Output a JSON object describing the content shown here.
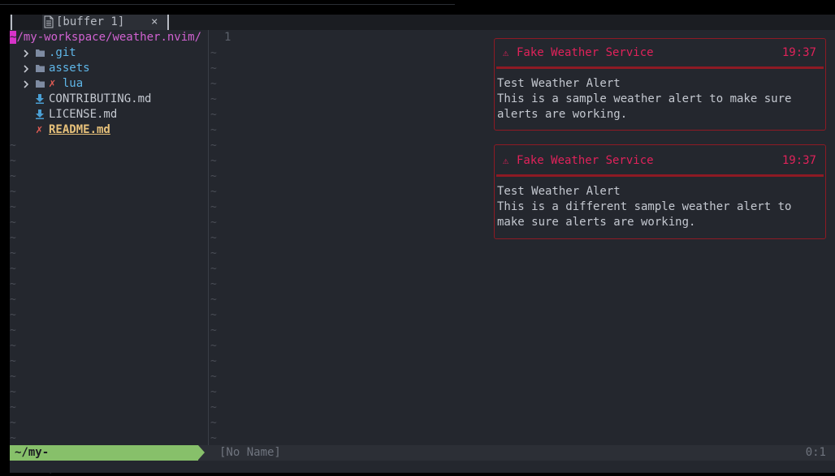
{
  "tabline": {
    "tab_label": "[buffer 1]",
    "close_glyph": "×"
  },
  "tree": {
    "root_cursor": "~",
    "root_path": "/my-workspace/weather.nvim/",
    "items": [
      {
        "name": ".git",
        "kind": "dir",
        "icon": "folder-icon"
      },
      {
        "name": "assets",
        "kind": "dir",
        "icon": "folder-icon"
      },
      {
        "name": "lua",
        "kind": "dir",
        "icon": "folder-icon",
        "status": "✗"
      },
      {
        "name": "CONTRIBUTING.md",
        "kind": "file",
        "icon": "markdown-download-icon"
      },
      {
        "name": "LICENSE.md",
        "kind": "file",
        "icon": "markdown-download-icon"
      },
      {
        "name": "README.md",
        "kind": "file",
        "status": "✗"
      }
    ]
  },
  "editor": {
    "line_number": "1",
    "tilde": "~"
  },
  "notifications": [
    {
      "icon": "⚠",
      "title": "Fake Weather Service",
      "time": "19:37",
      "heading": "Test Weather Alert",
      "body": "This is a sample weather alert to make sure alerts are working."
    },
    {
      "icon": "⚠",
      "title": "Fake Weather Service",
      "time": "19:37",
      "heading": "Test Weather Alert",
      "body": "This is a different sample weather alert to make sure alerts are working."
    }
  ],
  "statusline": {
    "path": "~/my-workspace/weather.nvim",
    "buffer_name": "[No Name]",
    "position": "0:1"
  },
  "colors": {
    "background": "#24272e",
    "accent_magenta": "#d733c9",
    "dir_blue": "#5fb6e8",
    "error_red": "#e0225a",
    "mode_green": "#87c06a"
  }
}
